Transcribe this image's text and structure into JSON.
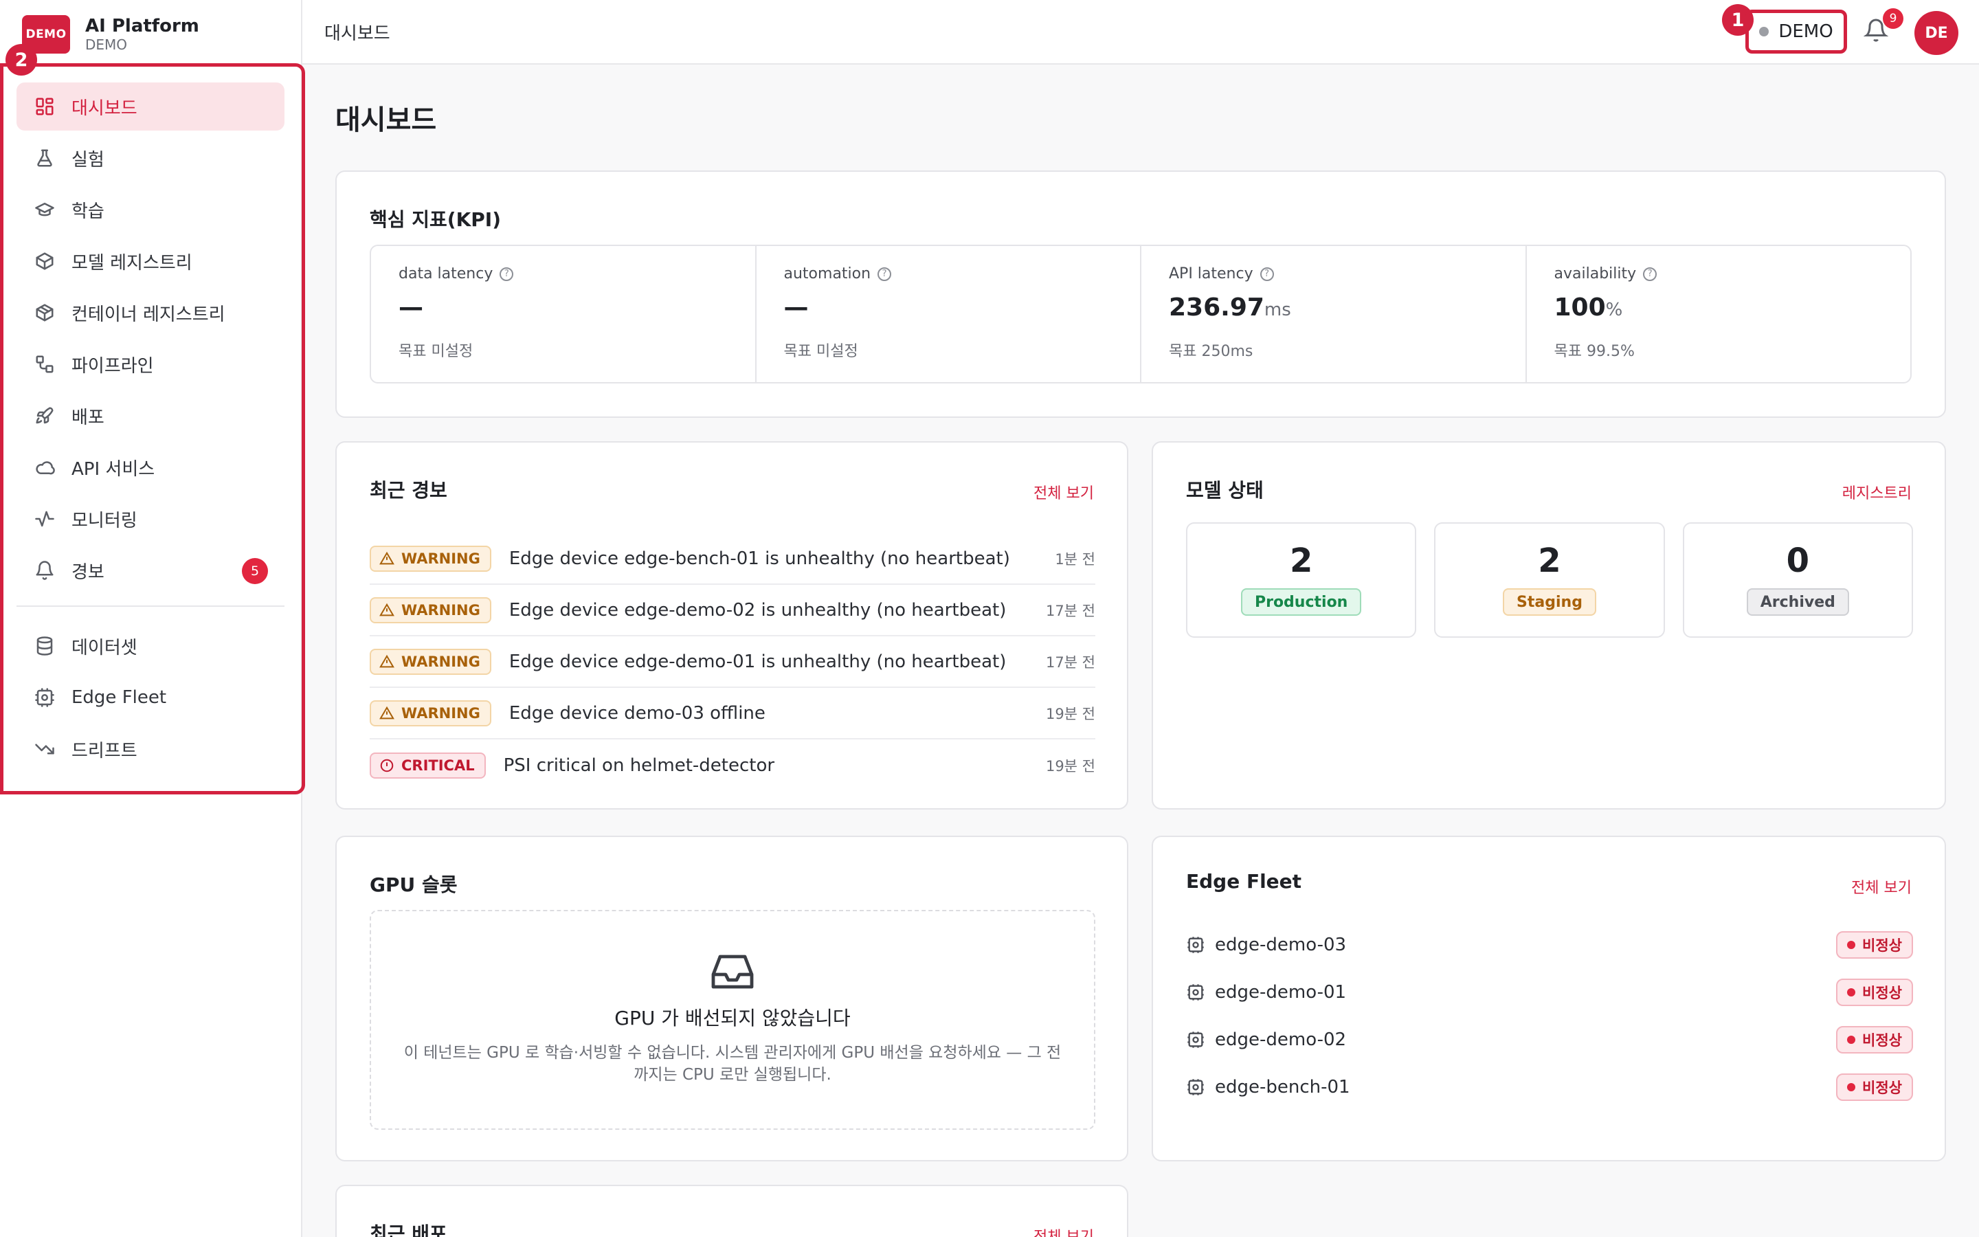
{
  "brand": {
    "logo": "DEMO",
    "name": "AI Platform",
    "sub": "DEMO"
  },
  "markers": [
    "1",
    "2"
  ],
  "sidebar": {
    "items": [
      {
        "label": "대시보드",
        "icon": "dashboard-icon",
        "active": true
      },
      {
        "label": "실험",
        "icon": "flask-icon"
      },
      {
        "label": "학습",
        "icon": "graduation-cap-icon"
      },
      {
        "label": "모델 레지스트리",
        "icon": "box-icon"
      },
      {
        "label": "컨테이너 레지스트리",
        "icon": "package-icon"
      },
      {
        "label": "파이프라인",
        "icon": "workflow-icon"
      },
      {
        "label": "배포",
        "icon": "rocket-icon"
      },
      {
        "label": "API 서비스",
        "icon": "cloud-icon"
      },
      {
        "label": "모니터링",
        "icon": "activity-icon"
      },
      {
        "label": "경보",
        "icon": "bell-icon",
        "badge": "5"
      }
    ],
    "secondary": [
      {
        "label": "데이터셋",
        "icon": "database-icon"
      },
      {
        "label": "Edge Fleet",
        "icon": "edge-device-icon"
      },
      {
        "label": "드리프트",
        "icon": "trending-down-icon"
      }
    ]
  },
  "header": {
    "title": "대시보드",
    "tenant": "DEMO",
    "notifications": "9",
    "avatar": "DE"
  },
  "page_title": "대시보드",
  "kpi": {
    "title": "핵심 지표(KPI)",
    "help": "?",
    "items": [
      {
        "label": "data latency",
        "value": "—",
        "unit": "",
        "target": "목표 미설정"
      },
      {
        "label": "automation",
        "value": "—",
        "unit": "",
        "target": "목표 미설정"
      },
      {
        "label": "API latency",
        "value": "236.97",
        "unit": "ms",
        "target": "목표 250ms"
      },
      {
        "label": "availability",
        "value": "100",
        "unit": "%",
        "target": "목표 99.5%"
      }
    ]
  },
  "alerts": {
    "title": "최근 경보",
    "link": "전체 보기",
    "rows": [
      {
        "severity": "WARNING",
        "message": "Edge device edge-bench-01 is unhealthy (no heartbeat)",
        "time": "1분 전"
      },
      {
        "severity": "WARNING",
        "message": "Edge device edge-demo-02 is unhealthy (no heartbeat)",
        "time": "17분 전"
      },
      {
        "severity": "WARNING",
        "message": "Edge device edge-demo-01 is unhealthy (no heartbeat)",
        "time": "17분 전"
      },
      {
        "severity": "WARNING",
        "message": "Edge device demo-03 offline",
        "time": "19분 전"
      },
      {
        "severity": "CRITICAL",
        "message": "PSI critical on helmet-detector",
        "time": "19분 전"
      }
    ]
  },
  "models": {
    "title": "모델 상태",
    "link": "레지스트리",
    "stages": [
      {
        "count": "2",
        "label": "Production"
      },
      {
        "count": "2",
        "label": "Staging"
      },
      {
        "count": "0",
        "label": "Archived"
      }
    ]
  },
  "gpu": {
    "title": "GPU 슬롯",
    "empty_title": "GPU 가 배선되지 않았습니다",
    "empty_desc": "이 테넌트는 GPU 로 학습·서빙할 수 없습니다. 시스템 관리자에게 GPU 배선을 요청하세요 — 그 전까지는 CPU 로만 실행됩니다."
  },
  "fleet": {
    "title": "Edge Fleet",
    "link": "전체 보기",
    "devices": [
      {
        "name": "edge-demo-03",
        "status": "비정상"
      },
      {
        "name": "edge-demo-01",
        "status": "비정상"
      },
      {
        "name": "edge-demo-02",
        "status": "비정상"
      },
      {
        "name": "edge-bench-01",
        "status": "비정상"
      }
    ]
  },
  "deploys": {
    "title": "최근 배포",
    "link": "전체 보기"
  }
}
